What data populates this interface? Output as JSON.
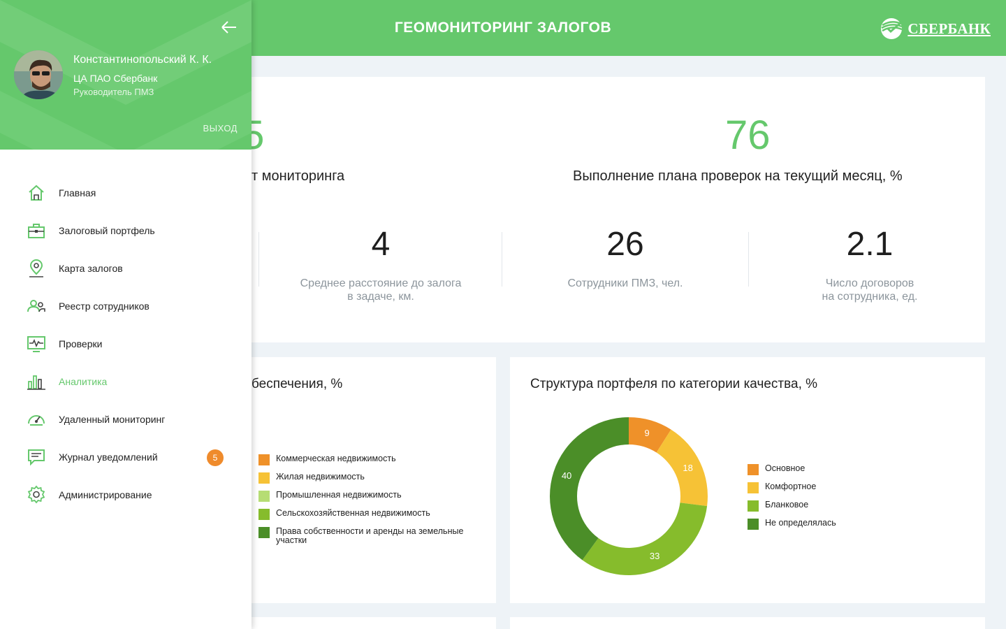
{
  "header": {
    "title": "ГЕОМОНИТОРИНГ ЗАЛОГОВ",
    "brand": "СБЕРБАНК"
  },
  "kpi": {
    "main_left": {
      "value_fragment": ".5",
      "label_fragment": "т мониторинга"
    },
    "main_right": {
      "value": "76",
      "label": "Выполнение плана проверок на текущий месяц, %"
    },
    "stats": [
      {
        "value": "4",
        "label_line1": "Среднее расстояние до залога",
        "label_line2": "в задаче, км."
      },
      {
        "value": "26",
        "label_line1": "Сотрудники ПМЗ, чел.",
        "label_line2": ""
      },
      {
        "value": "2.1",
        "label_line1": "Число договоров",
        "label_line2": "на сотрудника, ед."
      }
    ]
  },
  "collateral_card": {
    "title_fragment": "беспечения, %",
    "legend": [
      {
        "label": "Коммерческая недвижимость",
        "color": "#ef9129"
      },
      {
        "label": "Жилая недвижимость",
        "color": "#f6c236"
      },
      {
        "label": "Промышленная недвижимость",
        "color": "#b6dd74"
      },
      {
        "label": "Сельскохозяйственная недвижимость",
        "color": "#86bc2c"
      },
      {
        "label_line1": "Права собственности и аренды на земельные",
        "label_line2": "участки",
        "color": "#4b8e28"
      }
    ]
  },
  "quality_card": {
    "title": "Структура портфеля по категории качества, %",
    "chart_data": {
      "type": "pie",
      "categories": [
        "Основное",
        "Комфортное",
        "Бланковое",
        "Не определялась"
      ],
      "values": [
        9,
        18,
        33,
        40
      ],
      "colors": [
        "#ef9129",
        "#f6c236",
        "#86bc2c",
        "#4b8e28"
      ],
      "title": "Структура портфеля по категории качества, %"
    },
    "legend": [
      {
        "label": "Основное",
        "color": "#ef9129"
      },
      {
        "label": "Комфортное",
        "color": "#f6c236"
      },
      {
        "label": "Бланковое",
        "color": "#86bc2c"
      },
      {
        "label": "Не определялась",
        "color": "#4b8e28"
      }
    ]
  },
  "drawer": {
    "user": {
      "name": "Константинопольский К. К.",
      "org": "ЦА ПАО Сбербанк",
      "role": "Руководитель ПМЗ"
    },
    "logout_label": "ВЫХОД",
    "nav": [
      {
        "label": "Главная",
        "icon": "home-icon"
      },
      {
        "label": "Залоговый портфель",
        "icon": "briefcase-icon"
      },
      {
        "label": "Карта залогов",
        "icon": "map-pin-icon"
      },
      {
        "label": "Реестр сотрудников",
        "icon": "users-icon"
      },
      {
        "label": "Проверки",
        "icon": "monitor-pulse-icon"
      },
      {
        "label": "Аналитика",
        "icon": "bar-chart-icon",
        "active": true
      },
      {
        "label": "Удаленный мониторинг",
        "icon": "speedometer-icon"
      },
      {
        "label": "Журнал уведомлений",
        "icon": "message-icon",
        "badge": "5"
      },
      {
        "label": "Администрирование",
        "icon": "gear-icon"
      }
    ]
  },
  "colors": {
    "accent": "#65c86c",
    "badge": "#ef8b2c"
  }
}
